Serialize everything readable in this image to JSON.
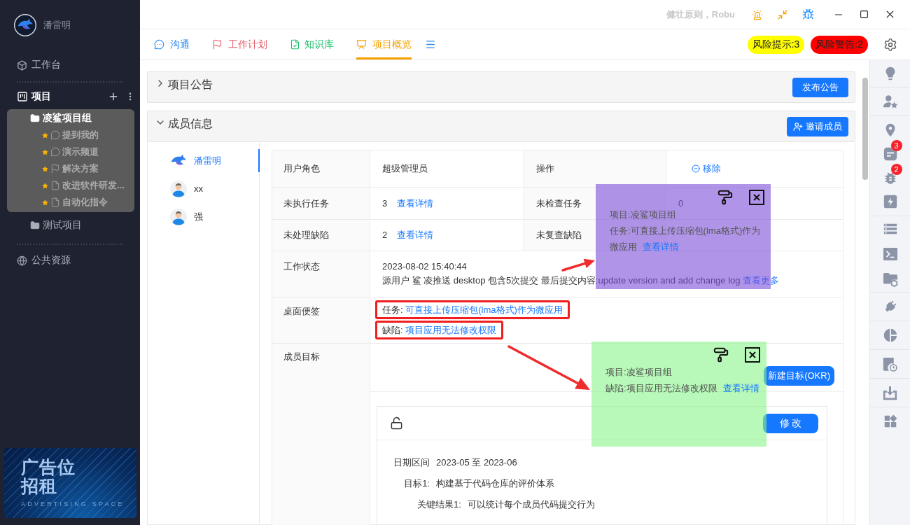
{
  "sidebar": {
    "user": {
      "name": "潘雷明"
    },
    "workbench": {
      "label": "工作台"
    },
    "projects": {
      "label": "项目",
      "items": [
        {
          "label": "凌鲨项目组",
          "selected": true,
          "children": [
            {
              "label": "提到我的",
              "kind": "chat",
              "starred": true
            },
            {
              "label": "演示频道",
              "kind": "chat",
              "starred": true
            },
            {
              "label": "解决方案",
              "kind": "flag",
              "starred": true
            },
            {
              "label": "改进软件研发...",
              "kind": "doc",
              "starred": true
            },
            {
              "label": "自动化指令",
              "kind": "doc",
              "starred": true
            }
          ]
        },
        {
          "label": "测试项目",
          "selected": false
        }
      ]
    },
    "public_resources": {
      "label": "公共资源"
    },
    "ad": {
      "lines": [
        "广告位",
        "招租"
      ],
      "caption": "ADVERTISING SPACE"
    }
  },
  "title_bar": {
    "ticker": "健壮原则，Robu"
  },
  "tabs": [
    {
      "label": "沟通",
      "kind": "chat",
      "color": "#2d8cf0",
      "selected": false
    },
    {
      "label": "工作计划",
      "kind": "plan",
      "color": "#e5606a",
      "selected": false
    },
    {
      "label": "知识库",
      "kind": "wiki",
      "color": "#19be6b",
      "selected": false
    },
    {
      "label": "项目概览",
      "kind": "overview",
      "color": "#f5a000",
      "selected": true
    }
  ],
  "risk_badges": [
    {
      "label": "风险提示:3",
      "kind": "hint"
    },
    {
      "label": "风险警告:2",
      "kind": "warning"
    }
  ],
  "panels": [
    {
      "kind": "notice",
      "title": "项目公告",
      "expanded": false,
      "button": "发布公告"
    },
    {
      "kind": "members",
      "title": "成员信息",
      "expanded": true,
      "button": "邀请成员",
      "members": [
        {
          "name": "潘雷明",
          "kind": "logo",
          "selected": true
        },
        {
          "name": "xx",
          "kind": "person",
          "selected": false
        },
        {
          "name": "强",
          "kind": "person",
          "selected": false
        }
      ],
      "info": {
        "role": {
          "label": "用户角色",
          "value": "超级管理员",
          "action_label": "操作",
          "action": "移除"
        },
        "counters": [
          {
            "label": "未执行任务",
            "count": "3",
            "link": "查看详情",
            "check_label": "未检查任务",
            "check_count": "0"
          },
          {
            "label": "未处理缺陷",
            "count": "2",
            "link": "查看详情",
            "check_label": "未复查缺陷"
          }
        ],
        "work_status": {
          "label": "工作状态",
          "time": "2023-08-02 15:40:44",
          "text": "源用户 鲨 凌推送 desktop 包含5次提交 最后提交内容:update version and add change log",
          "link": "查看更多"
        },
        "desk_notes": {
          "label": "桌面便签",
          "items": [
            {
              "prefix": "任务:",
              "text": "可直接上传压缩包(lma格式)作为微应用",
              "highlighted": true
            },
            {
              "prefix": "缺陷:",
              "text": "项目应用无法修改权限",
              "highlighted": true
            }
          ]
        },
        "goals": {
          "label": "成员目标",
          "new_button": "新建目标(OKR)",
          "card": {
            "locked": false,
            "edit_button": "修 改",
            "fields": [
              {
                "kind": "field",
                "label": "日期区间",
                "value": "2023-05 至 2023-06"
              },
              {
                "kind": "field",
                "label": "目标1:",
                "value": "构建基于代码仓库的评价体系"
              },
              {
                "kind": "key_result",
                "label": "关键结果1:",
                "value": "可以统计每个成员代码提交行为"
              }
            ]
          }
        }
      }
    }
  ],
  "sticky_notes": [
    {
      "color": "#b094e8",
      "project": "项目:凌鲨项目组",
      "body": "任务:可直接上传压缩包(lma格式)作为微应用",
      "link": "查看详情",
      "arrow": true
    },
    {
      "color": "#b8f8b8",
      "project": "项目:凌鲨项目组",
      "body": "缺陷:项目应用无法修改权限",
      "link": "查看详情",
      "arrow": true
    }
  ],
  "right_toolbar": {
    "notes_badge": "3",
    "bugs_badge": "2"
  }
}
